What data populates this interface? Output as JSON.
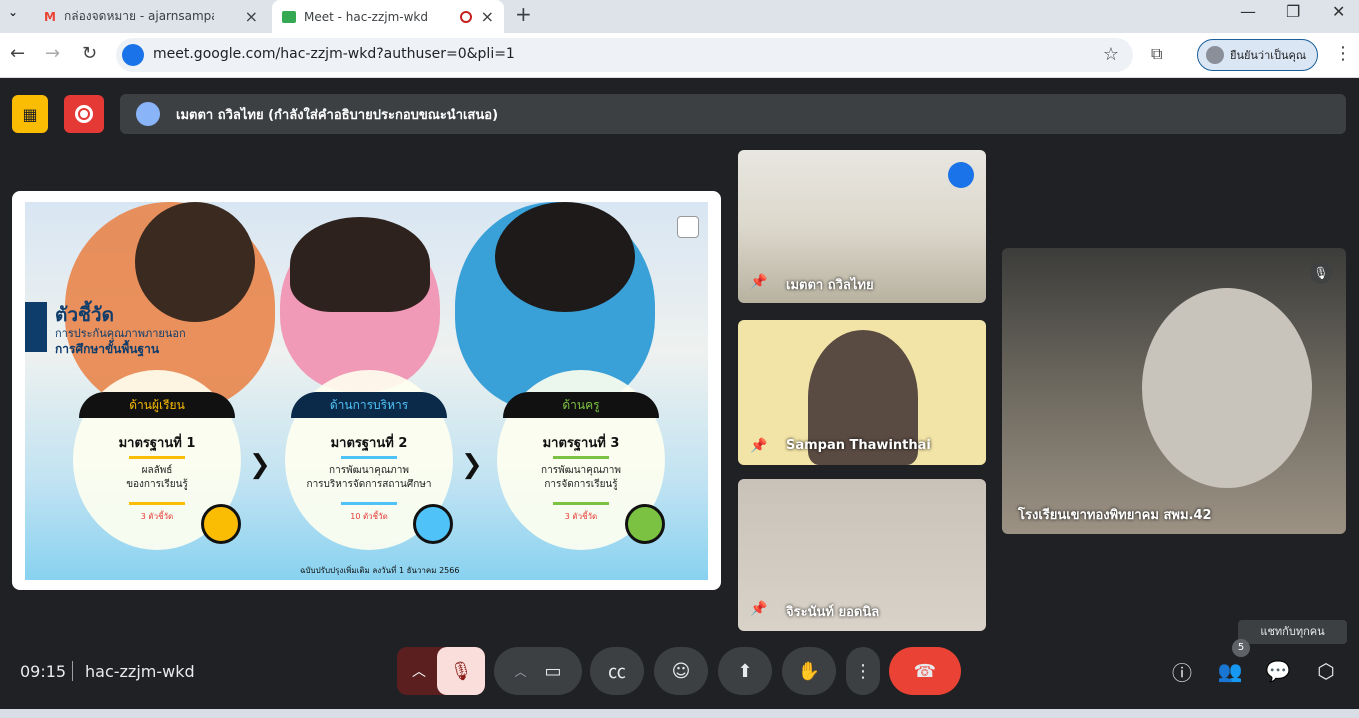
{
  "browser": {
    "tabs": [
      {
        "title": "กล่องจดหมาย - ajarnsampan@gm",
        "close": "×"
      },
      {
        "title": "Meet - hac-zzjm-wkd",
        "close": "×"
      }
    ],
    "new_tab": "+",
    "url": "meet.google.com/hac-zzjm-wkd?authuser=0&pli=1",
    "profile_label": "ยืนยันว่าเป็นคุณ"
  },
  "meet": {
    "presenter_bar": "เมตตา ถวิลไทย (กำลังใส่คำอธิบายประกอบขณะนำเสนอ)",
    "slide": {
      "title": "ตัวชี้วัด",
      "subtitle1": "การประกันคุณภาพภายนอก",
      "subtitle2": "การศึกษาขั้นพื้นฐาน",
      "cards": [
        {
          "band": "ด้านผู้เรียน",
          "standard": "มาตรฐานที่ 1",
          "desc1": "ผลลัพธ์",
          "desc2": "ของการเรียนรู้",
          "count": "3 ตัวชี้วัด"
        },
        {
          "band": "ด้านการบริหาร",
          "standard": "มาตรฐานที่ 2",
          "desc1": "การพัฒนาคุณภาพ",
          "desc2": "การบริหารจัดการสถานศึกษา",
          "count": "10 ตัวชี้วัด"
        },
        {
          "band": "ด้านครู",
          "standard": "มาตรฐานที่ 3",
          "desc1": "การพัฒนาคุณภาพ",
          "desc2": "การจัดการเรียนรู้",
          "count": "3 ตัวชี้วัด"
        }
      ],
      "footer": "ฉบับปรับปรุงเพิ่มเติม ลงวันที่ 1 ธันวาคม 2566"
    },
    "participants": [
      {
        "name": "เมตตา ถวิลไทย"
      },
      {
        "name": "Sampan Thawinthai"
      },
      {
        "name": "จิระนันท์ ยอดนิล"
      },
      {
        "name": "โรงเรียนเขาทองพิทยาคม สพม.42"
      }
    ],
    "time": "09:15",
    "meeting_code": "hac-zzjm-wkd",
    "people_count": "5",
    "tooltip": "แชทกับทุกคน"
  },
  "colors": {
    "background": "#202124",
    "end_call": "#ea4335",
    "host": "#fbbc04",
    "record": "#e53935"
  }
}
